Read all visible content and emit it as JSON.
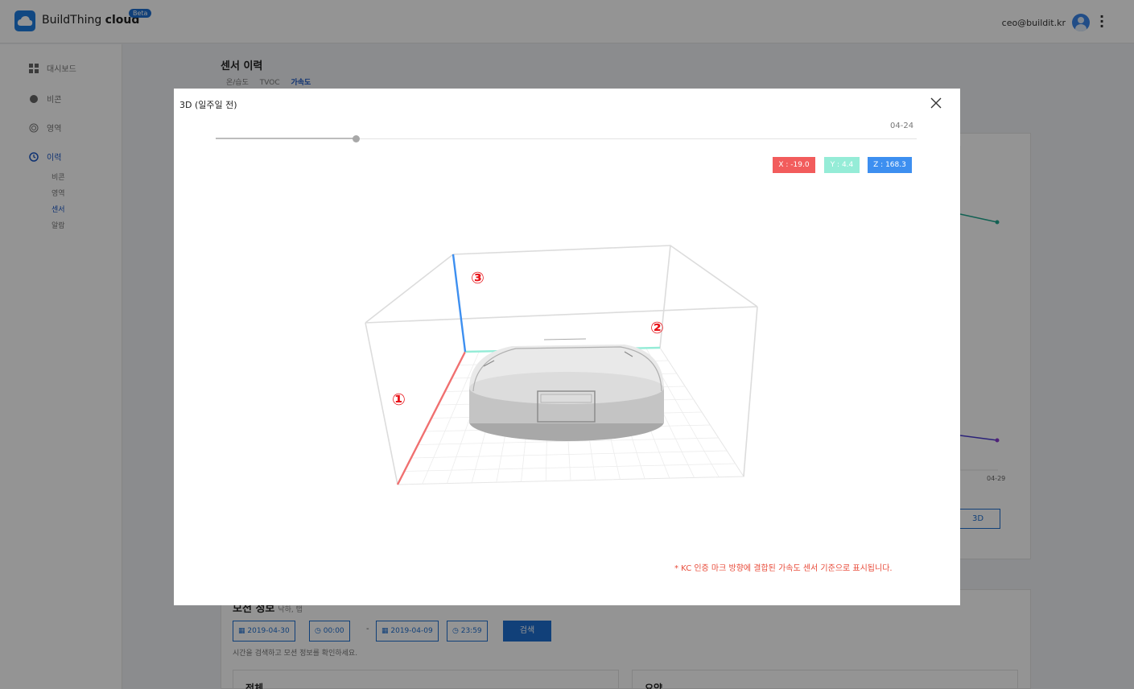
{
  "app": {
    "brand_name": "BuildThing",
    "brand_suffix": "cloud",
    "beta": "Beta",
    "user_email": "ceo@buildit.kr"
  },
  "sidebar": {
    "items": [
      {
        "label": "대시보드",
        "icon": "dashboard-icon"
      },
      {
        "label": "비콘",
        "icon": "beacon-icon"
      },
      {
        "label": "영역",
        "icon": "area-icon"
      },
      {
        "label": "이력",
        "icon": "history-icon"
      }
    ],
    "subitems": [
      "비콘",
      "영역",
      "센서",
      "알람"
    ],
    "active_sub": "센서"
  },
  "page": {
    "title": "센서 이력",
    "tabs": [
      "온/습도",
      "TVOC",
      "가속도"
    ],
    "active_tab": "가속도",
    "chart_axis_label": "04-29",
    "btn_3d": "3D"
  },
  "motion": {
    "title": "모션 정보",
    "subtitle": "낙하, 탭",
    "start_date": "2019-04-30",
    "start_time": "00:00",
    "dash": "-",
    "end_date": "2019-04-09",
    "end_time": "23:59",
    "search_label": "검색",
    "hint": "시간을 검색하고 모션 정보를 확인하세요.",
    "panel_total": "전체",
    "panel_summary": "요약"
  },
  "modal": {
    "title": "3D (일주일 전)",
    "slider_date": "04-24",
    "slider_fraction": 0.2,
    "x_badge": "X : -19.0",
    "y_badge": "Y : 4.4",
    "z_badge": "Z : 168.3",
    "x_color": "#f25c5c",
    "y_color": "#95ecd7",
    "z_color": "#3d8ff0",
    "markers": [
      "①",
      "②",
      "③"
    ],
    "note": "* KC 인증 마크 방향에 결합된 가속도 센서 기준으로 표시됩니다."
  }
}
